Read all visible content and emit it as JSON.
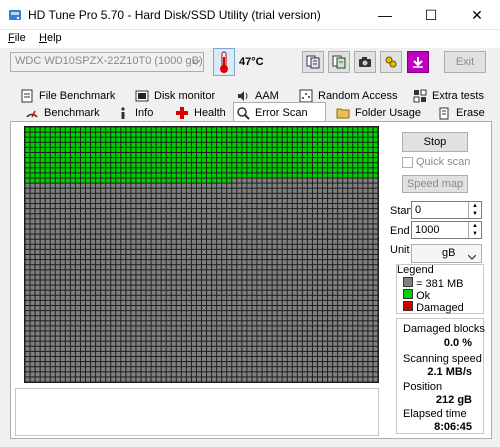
{
  "window": {
    "title": "HD Tune Pro 5.70 - Hard Disk/SSD Utility (trial version)",
    "controls": {
      "minimize": "—",
      "maximize": "☐",
      "close": "✕"
    }
  },
  "menu": [
    "File",
    "Help"
  ],
  "toolbar": {
    "drive": "WDC WD10SPZX-22Z10T0 (1000 gB)",
    "temperature": "47°C",
    "icons": [
      "copy-info-icon",
      "save-icon",
      "screenshot-icon",
      "options-icon",
      "download-icon"
    ],
    "exit_label": "Exit"
  },
  "tabs": {
    "row1": [
      "File Benchmark",
      "Disk monitor",
      "AAM",
      "Random Access",
      "Extra tests"
    ],
    "row2": [
      "Benchmark",
      "Info",
      "Health",
      "Error Scan",
      "Folder Usage",
      "Erase"
    ],
    "active": "Error Scan"
  },
  "error_scan": {
    "scanned_fraction": 0.2118,
    "colors": {
      "ok": "#00d000",
      "unscanned": "#808080",
      "damaged": "#d00000",
      "grid_line": "#1e1e1e"
    },
    "stop_label": "Stop",
    "quick_scan_label": "Quick scan",
    "quick_scan_checked": false,
    "speed_map_label": "Speed map",
    "start_label": "Start",
    "start_value": "0",
    "end_label": "End",
    "end_value": "1000",
    "unit_label": "Unit",
    "unit_value": "gB",
    "legend": {
      "title": "Legend",
      "block_size": "= 381 MB",
      "ok": "Ok",
      "damaged": "Damaged"
    },
    "stats": {
      "damaged_blocks_label": "Damaged blocks",
      "damaged_blocks_value": "0.0 %",
      "scanning_speed_label": "Scanning speed",
      "scanning_speed_value": "2.1 MB/s",
      "position_label": "Position",
      "position_value": "212 gB",
      "elapsed_label": "Elapsed time",
      "elapsed_value": "8:06:45"
    }
  }
}
